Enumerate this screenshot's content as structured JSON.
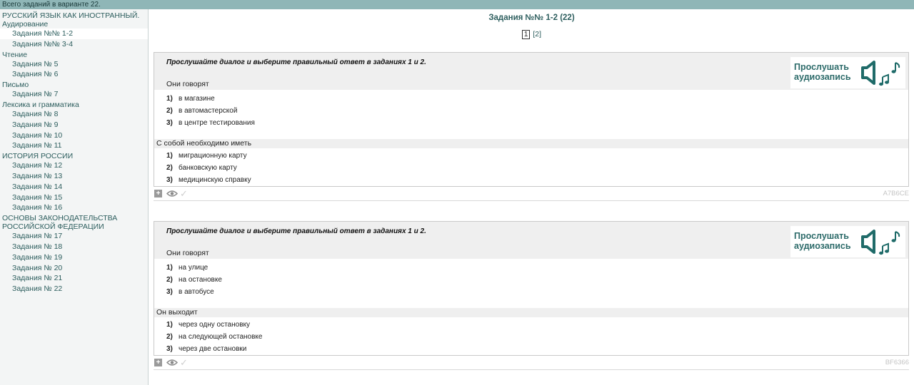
{
  "topbar": {
    "text": "Всего заданий в варианте 22."
  },
  "sidebar": {
    "sections": [
      {
        "title": "РУССКИЙ ЯЗЫК КАК ИНОСТРАННЫЙ.",
        "items": []
      },
      {
        "title": "Аудирование",
        "items": [
          "Задания №№ 1-2",
          "Задания №№ 3-4"
        ]
      },
      {
        "title": "Чтение",
        "items": [
          "Задания № 5",
          "Задания № 6"
        ]
      },
      {
        "title": "Письмо",
        "items": [
          "Задания № 7"
        ]
      },
      {
        "title": "Лексика и грамматика",
        "items": [
          "Задания № 8",
          "Задания № 9",
          "Задания № 10",
          "Задания № 11"
        ]
      },
      {
        "title": "ИСТОРИЯ РОССИИ",
        "items": [
          "Задания № 12",
          "Задания № 13",
          "Задания № 14",
          "Задания № 15",
          "Задания № 16"
        ]
      },
      {
        "title": "ОСНОВЫ ЗАКОНОДАТЕЛЬСТВА",
        "items": []
      },
      {
        "title": "РОССИЙСКОЙ ФЕДЕРАЦИИ",
        "items": [
          "Задания № 17",
          "Задания № 18",
          "Задания № 19",
          "Задания № 20",
          "Задания № 21",
          "Задания № 22"
        ]
      }
    ]
  },
  "main": {
    "title": "Задания №№ 1-2 (22)",
    "pager": {
      "current": "1",
      "other": "[2]"
    }
  },
  "tasks": [
    {
      "instruction": "Прослушайте диалог и выберите правильный ответ в заданиях 1 и 2.",
      "audio_label_1": "Прослушать",
      "audio_label_2": "аудиозапись",
      "q1": "Они говорят",
      "q1_options": [
        {
          "num": "1)",
          "text": "в магазине"
        },
        {
          "num": "2)",
          "text": "в автомастерской"
        },
        {
          "num": "3)",
          "text": "в центре тестирования"
        }
      ],
      "q2": "С собой необходимо иметь",
      "q2_options": [
        {
          "num": "1)",
          "text": "миграционную карту"
        },
        {
          "num": "2)",
          "text": "банковскую карту"
        },
        {
          "num": "3)",
          "text": "медицинскую справку"
        }
      ],
      "footer": {
        "plus": "+",
        "code": "A7B6CE"
      }
    },
    {
      "instruction": "Прослушайте диалог и выберите правильный ответ в заданиях 1 и 2.",
      "audio_label_1": "Прослушать",
      "audio_label_2": "аудиозапись",
      "q1": "Они говорят",
      "q1_options": [
        {
          "num": "1)",
          "text": "на улице"
        },
        {
          "num": "2)",
          "text": "на остановке"
        },
        {
          "num": "3)",
          "text": "в автобусе"
        }
      ],
      "q2": "Он выходит",
      "q2_options": [
        {
          "num": "1)",
          "text": "через одну остановку"
        },
        {
          "num": "2)",
          "text": "на следующей остановке"
        },
        {
          "num": "3)",
          "text": "через две остановки"
        }
      ],
      "footer": {
        "plus": "+",
        "code": "BF6366"
      }
    }
  ],
  "colors": {
    "accent": "#2d5e5e",
    "topbar": "#8fb6b7",
    "audio": "#2d6b6a"
  }
}
